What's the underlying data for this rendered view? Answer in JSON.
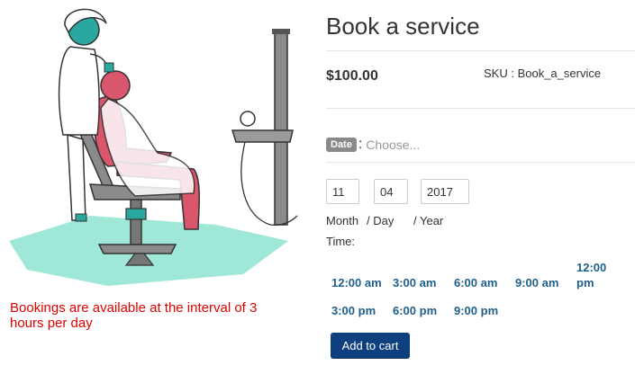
{
  "product": {
    "title": "Book a service",
    "price": "$100.00",
    "sku": "SKU : Book_a_service"
  },
  "date": {
    "badge": "Date",
    "colon": ":",
    "placeholder": "Choose..."
  },
  "fields": {
    "day_value": "11",
    "month_value": "04",
    "year_value": "2017",
    "label_month": "Month",
    "label_day": "/ Day",
    "label_year": "/ Year"
  },
  "time": {
    "label": "Time:",
    "slots": [
      "12:00 am",
      "3:00 am",
      "6:00 am",
      "9:00 am",
      "12:00 pm",
      "3:00 pm",
      "6:00 pm",
      "9:00 pm"
    ]
  },
  "note": "Bookings are available at the interval of 3 hours per day",
  "actions": {
    "add_to_cart": "Add to cart"
  },
  "colors": {
    "accent": "#0e3f7f",
    "slot_text": "#1f5f8b",
    "note_text": "#e00000"
  }
}
